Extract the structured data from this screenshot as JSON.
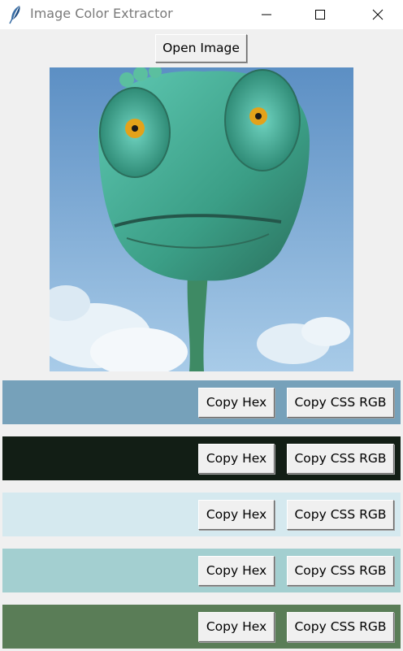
{
  "window": {
    "title": "Image Color Extractor",
    "icon": "feather-icon"
  },
  "toolbar": {
    "open_label": "Open Image"
  },
  "image": {
    "subject": "",
    "watermark": ""
  },
  "swatches": [
    {
      "color": "#76a1ba",
      "hex_label": "Copy Hex",
      "css_label": "Copy CSS RGB"
    },
    {
      "color": "#121e15",
      "hex_label": "Copy Hex",
      "css_label": "Copy CSS RGB"
    },
    {
      "color": "#d5e9ef",
      "hex_label": "Copy Hex",
      "css_label": "Copy CSS RGB"
    },
    {
      "color": "#a3cfd0",
      "hex_label": "Copy Hex",
      "css_label": "Copy CSS RGB"
    },
    {
      "color": "#5a7d57",
      "hex_label": "Copy Hex",
      "css_label": "Copy CSS RGB"
    }
  ]
}
